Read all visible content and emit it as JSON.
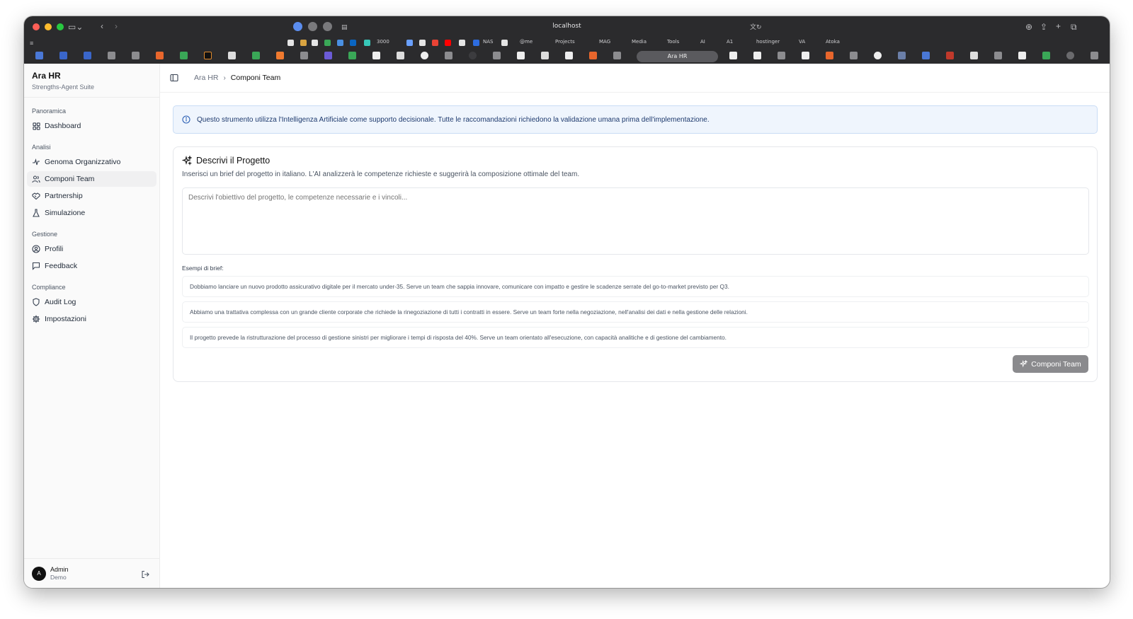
{
  "browser": {
    "url": "localhost",
    "bookmarks": [
      "3000",
      "NAS",
      "@me",
      "Projects",
      "MAG",
      "Media",
      "Tools",
      "AI",
      "A1",
      "hostinger",
      "VA",
      "Atoka"
    ],
    "active_tab": "Ara HR"
  },
  "sidebar": {
    "app_name": "Ara HR",
    "app_subtitle": "Strengths-Agent Suite",
    "groups": [
      {
        "label": "Panoramica",
        "items": [
          {
            "label": "Dashboard",
            "icon": "grid-icon"
          }
        ]
      },
      {
        "label": "Analisi",
        "items": [
          {
            "label": "Genoma Organizzativo",
            "icon": "sparkle-icon"
          },
          {
            "label": "Componi Team",
            "icon": "users-icon"
          },
          {
            "label": "Partnership",
            "icon": "handshake-icon"
          },
          {
            "label": "Simulazione",
            "icon": "flask-icon"
          }
        ]
      },
      {
        "label": "Gestione",
        "items": [
          {
            "label": "Profili",
            "icon": "user-circle-icon"
          },
          {
            "label": "Feedback",
            "icon": "message-icon"
          }
        ]
      },
      {
        "label": "Compliance",
        "items": [
          {
            "label": "Audit Log",
            "icon": "shield-icon"
          },
          {
            "label": "Impostazioni",
            "icon": "gear-icon"
          }
        ]
      }
    ],
    "user": {
      "initial": "A",
      "name": "Admin",
      "role": "Demo"
    }
  },
  "breadcrumb": {
    "root": "Ara HR",
    "current": "Componi Team"
  },
  "alert": {
    "text": "Questo strumento utilizza l'Intelligenza Artificiale come supporto decisionale. Tutte le raccomandazioni richiedono la validazione umana prima dell'implementazione."
  },
  "card": {
    "title": "Descrivi il Progetto",
    "description": "Inserisci un brief del progetto in italiano. L'AI analizzerà le competenze richieste e suggerirà la composizione ottimale del team.",
    "textarea_placeholder": "Descrivi l'obiettivo del progetto, le competenze necessarie e i vincoli...",
    "textarea_value": "",
    "examples_label": "Esempi di brief:",
    "examples": [
      "Dobbiamo lanciare un nuovo prodotto assicurativo digitale per il mercato under-35. Serve un team che sappia innovare, comunicare con impatto e gestire le scadenze serrate del go-to-market previsto per Q3.",
      "Abbiamo una trattativa complessa con un grande cliente corporate che richiede la rinegoziazione di tutti i contratti in essere. Serve un team forte nella negoziazione, nell'analisi dei dati e nella gestione delle relazioni.",
      "Il progetto prevede la ristrutturazione del processo di gestione sinistri per migliorare i tempi di risposta del 40%. Serve un team orientato all'esecuzione, con capacità analitiche e di gestione del cambiamento."
    ],
    "submit_label": "Componi Team"
  },
  "colors": {
    "alert_bg": "#eff5fd",
    "alert_text": "#1e3a6e",
    "button_disabled": "#8a8a8d"
  }
}
